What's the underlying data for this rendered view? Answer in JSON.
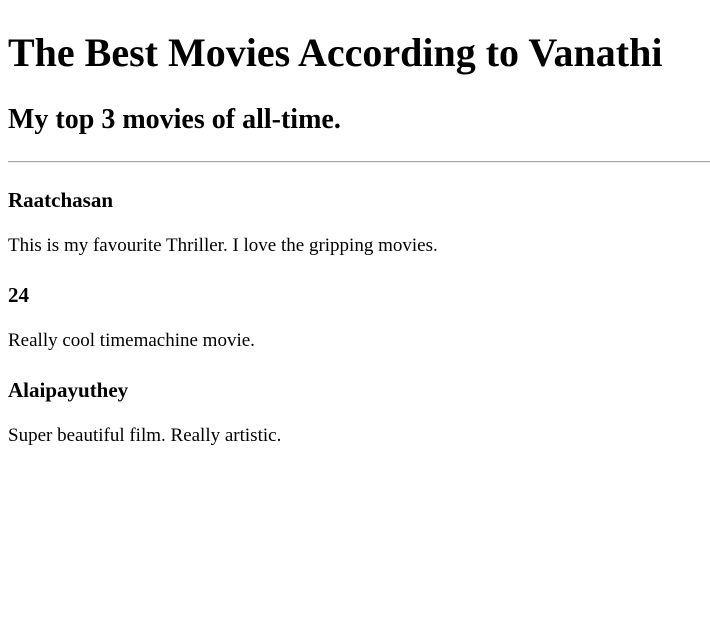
{
  "page": {
    "title": "The Best Movies According to Vanathi",
    "subtitle": "My top 3 movies of all-time."
  },
  "movies": [
    {
      "title": "Raatchasan",
      "description": "This is my favourite Thriller. I love the gripping movies."
    },
    {
      "title": "24",
      "description": "Really cool timemachine movie."
    },
    {
      "title": "Alaipayuthey",
      "description": "Super beautiful film. Really artistic."
    }
  ]
}
